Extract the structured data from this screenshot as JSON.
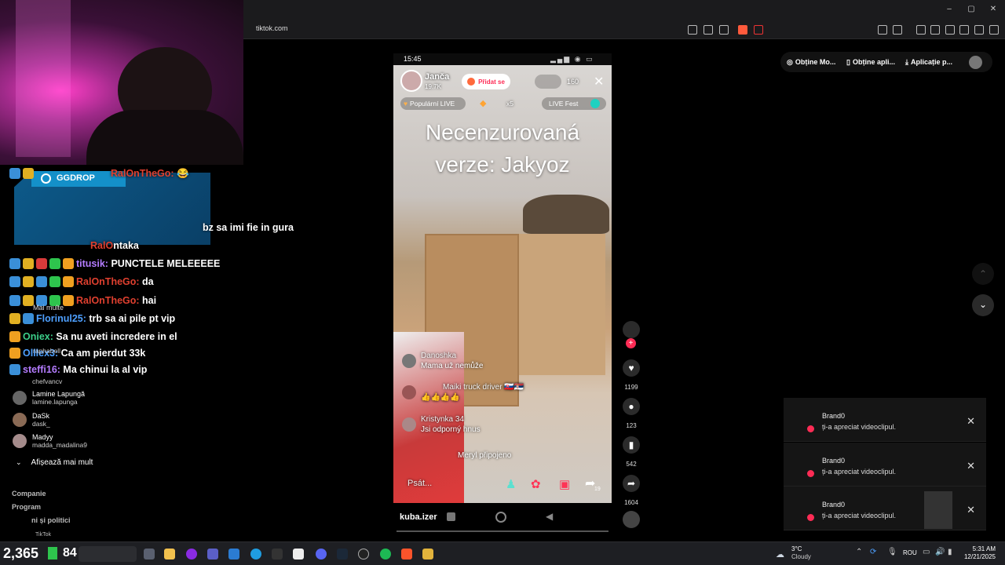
{
  "browser": {
    "url": "tiktok.com",
    "window_buttons": [
      "–",
      "▢",
      "✕"
    ]
  },
  "chat": {
    "lines": [
      {
        "user": "RalOnTheGo:",
        "msg": "😂",
        "color": "#e0402f"
      },
      {
        "user": "",
        "msg": "bz sa imi fie in gura",
        "color": "#e0402f"
      },
      {
        "user": "RalO",
        "msg": "ntaka",
        "color": "#e0402f"
      },
      {
        "user": "titusik:",
        "msg": "PUNCTELE MELEEEEE",
        "color": "#b47cff"
      },
      {
        "user": "RalOnTheGo:",
        "msg": "da",
        "color": "#e0402f"
      },
      {
        "user": "RalOnTheGo:",
        "msg": "hai",
        "color": "#e0402f"
      },
      {
        "user": "Florinul25:",
        "msg": "trb sa ai pile pt vip",
        "color": "#4ea0ff"
      },
      {
        "user": "Oniex:",
        "msg": "Sa nu aveti incredere in el",
        "color": "#3ccf8a"
      },
      {
        "user": "Olllex3:",
        "msg": "Ca am pierdut 33k",
        "color": "#4ea0ff"
      },
      {
        "user": "steffi16:",
        "msg": "Ma chinui la al vip",
        "color": "#b47cff"
      }
    ],
    "ggdrop_label": "GGDROP"
  },
  "sidebar": {
    "suggestions": [
      {
        "name": "Lamine Lapungă",
        "handle": "lamine.lapunga"
      },
      {
        "name": "DaSk",
        "handle": "dask_"
      },
      {
        "name": "Madyy",
        "handle": "madda_madalina9"
      }
    ],
    "partial": [
      {
        "name": "raphahell"
      },
      {
        "name": "chefvancv"
      }
    ],
    "mai_multe": "Mai multe",
    "show_more": "Afișează mai mult",
    "footer_links": [
      "Companie",
      "Program",
      "ni și politici"
    ]
  },
  "live": {
    "status_time": "15:45",
    "host_name": "Janča",
    "host_likes": "19.7K",
    "follow_label": "Přidat se",
    "viewer_count": "160",
    "tags": [
      "Populární LIVE",
      "x5",
      "LIVE Fest"
    ],
    "title": "Necenzurovaná verze: Jakyoz",
    "comments": [
      {
        "user": "Danoshka",
        "text": "Mama už nemůže"
      },
      {
        "user": "Maiki truck driver 🇸🇰🇷🇸",
        "text": "👍👍👍👍"
      },
      {
        "user": "Kristynka 34",
        "text": "Jsi odporný hnus"
      },
      {
        "user": "",
        "text": "Meryl připojeno"
      }
    ],
    "input_placeholder": "Psát...",
    "share_count": "19"
  },
  "rail": {
    "likes": "1199",
    "comments": "123",
    "saves": "542",
    "shares": "1604"
  },
  "top_actions": {
    "coins": "Obține Mo...",
    "app": "Obține apli...",
    "download": "Aplicație p..."
  },
  "notifications": [
    {
      "user": "Brand0",
      "text": "ți-a apreciat videoclipul."
    },
    {
      "user": "Brand0",
      "text": "ți-a apreciat videoclipul."
    },
    {
      "user": "Brand0",
      "text": "ți-a apreciat videoclipul."
    }
  ],
  "bottom_bar": {
    "username": "kuba.izer",
    "counter_left": "2,365",
    "counter_right": "84",
    "tiktok_label": "TikTok"
  },
  "taskbar": {
    "weather_temp": "3°C",
    "weather_desc": "Cloudy",
    "lang": "ROU",
    "time": "5:31 AM",
    "date": "12/21/2025"
  }
}
